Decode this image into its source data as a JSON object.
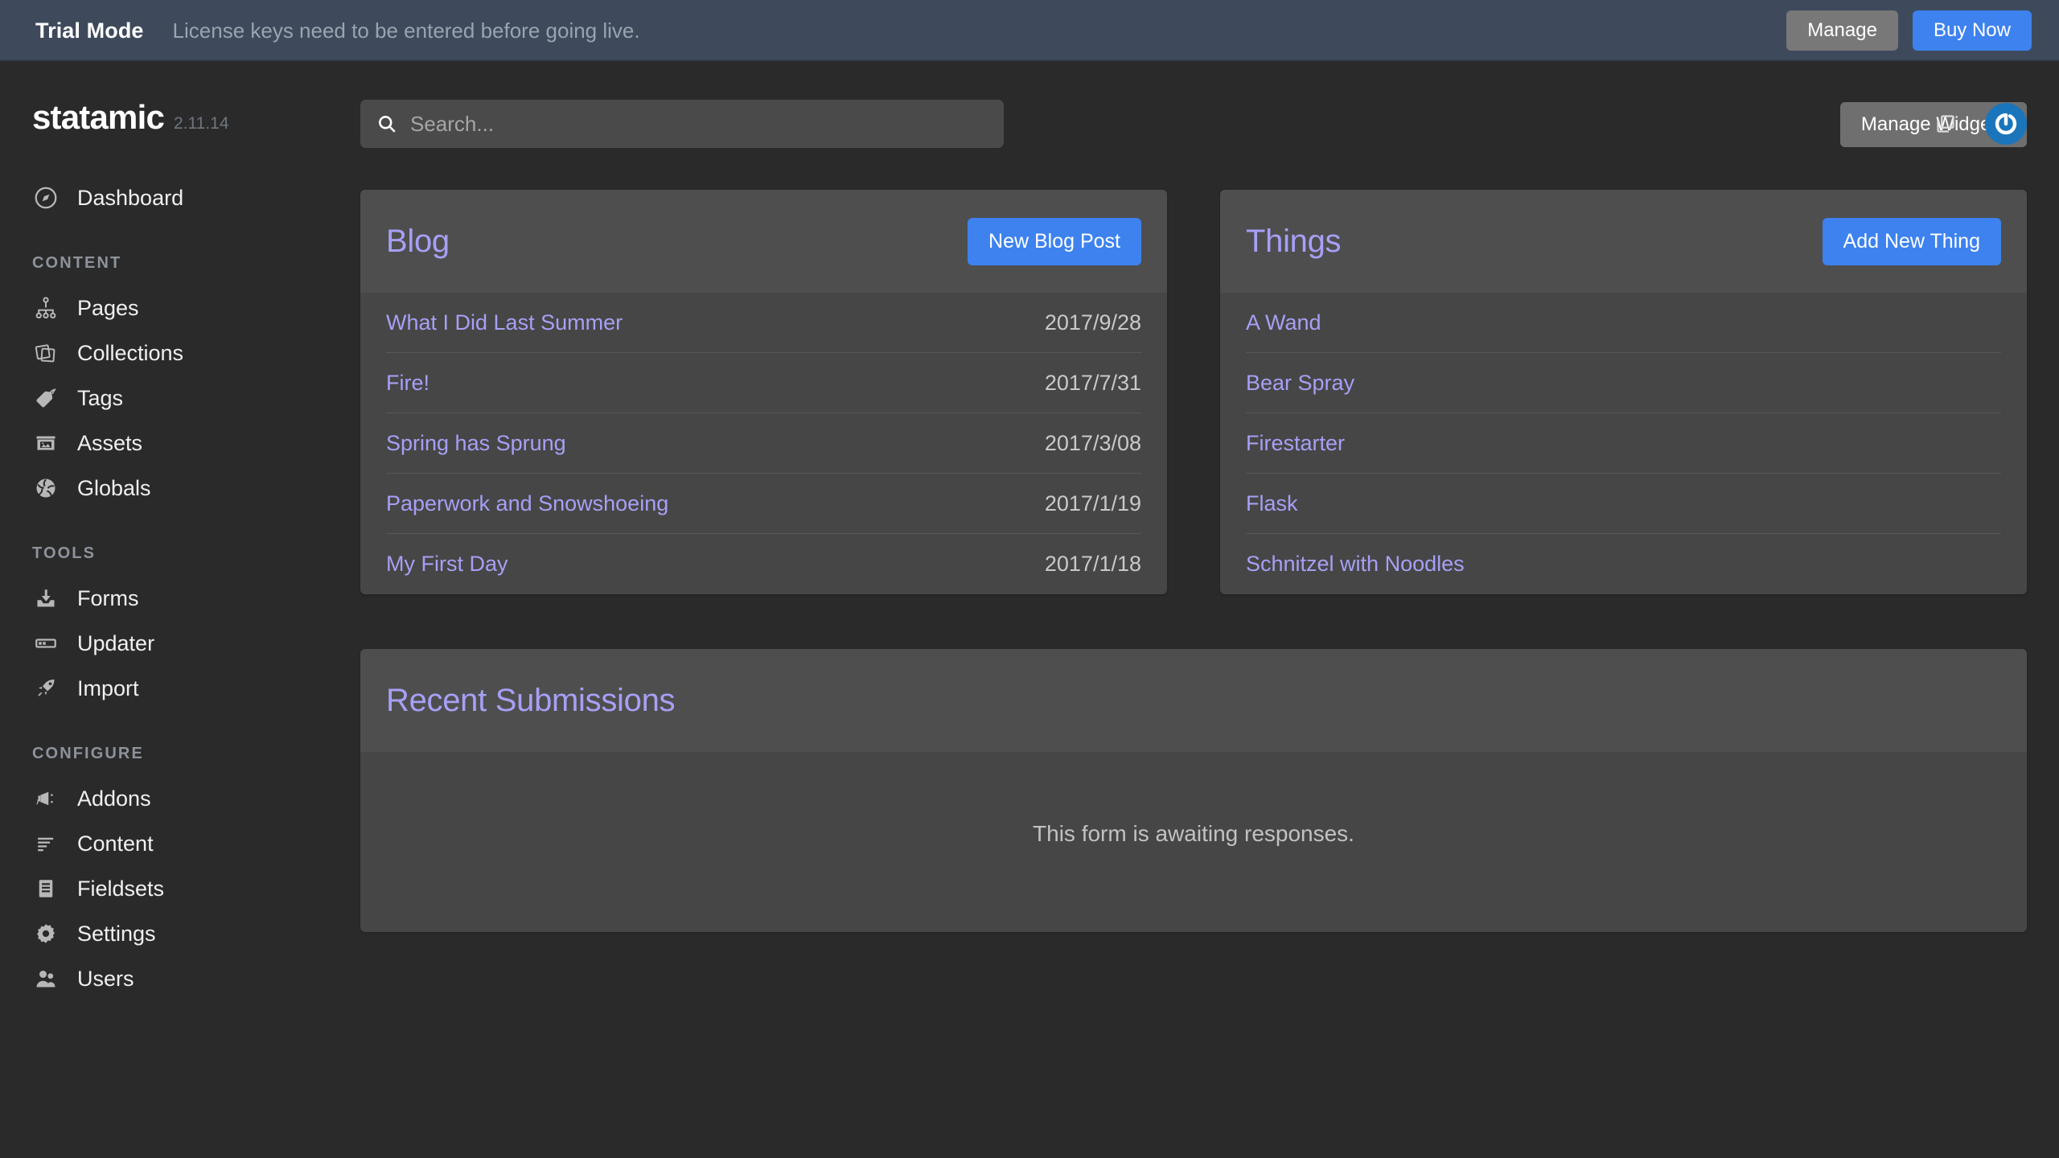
{
  "trial_bar": {
    "title": "Trial Mode",
    "message": "License keys need to be entered before going live.",
    "manage_label": "Manage",
    "buy_label": "Buy Now",
    "background_color": "#3e4a5c",
    "buy_color": "#3d82ef",
    "manage_color": "#787878"
  },
  "brand": {
    "name": "statamic",
    "version": "2.11.14"
  },
  "search": {
    "placeholder": "Search...",
    "value": "",
    "icon": "search-icon"
  },
  "header": {
    "copy_icon": "copy-windows-icon",
    "avatar_icon": "statamic-avatar-icon",
    "avatar_color": "#1b75bb"
  },
  "page": {
    "title": "Dashboard",
    "manage_widgets_label": "Manage Widgets"
  },
  "sidebar": {
    "primary": [
      {
        "label": "Dashboard",
        "icon": "compass-icon"
      }
    ],
    "sections": [
      {
        "label": "CONTENT",
        "items": [
          {
            "label": "Pages",
            "icon": "sitemap-icon"
          },
          {
            "label": "Collections",
            "icon": "stack-icon"
          },
          {
            "label": "Tags",
            "icon": "tag-icon"
          },
          {
            "label": "Assets",
            "icon": "image-folder-icon"
          },
          {
            "label": "Globals",
            "icon": "globe-icon"
          }
        ]
      },
      {
        "label": "TOOLS",
        "items": [
          {
            "label": "Forms",
            "icon": "inbox-download-icon"
          },
          {
            "label": "Updater",
            "icon": "progress-bar-icon"
          },
          {
            "label": "Import",
            "icon": "rocket-icon"
          }
        ]
      },
      {
        "label": "CONFIGURE",
        "items": [
          {
            "label": "Addons",
            "icon": "megaphone-icon"
          },
          {
            "label": "Content",
            "icon": "list-lines-icon"
          },
          {
            "label": "Fieldsets",
            "icon": "document-list-icon"
          },
          {
            "label": "Settings",
            "icon": "gear-icon"
          },
          {
            "label": "Users",
            "icon": "users-icon"
          }
        ]
      }
    ]
  },
  "widgets": {
    "accent_link_color": "#a6a0f5",
    "blog": {
      "title": "Blog",
      "action_label": "New Blog Post",
      "entries": [
        {
          "title": "What I Did Last Summer",
          "date": "2017/9/28"
        },
        {
          "title": "Fire!",
          "date": "2017/7/31"
        },
        {
          "title": "Spring has Sprung",
          "date": "2017/3/08"
        },
        {
          "title": "Paperwork and Snowshoeing",
          "date": "2017/1/19"
        },
        {
          "title": "My First Day",
          "date": "2017/1/18"
        }
      ]
    },
    "things": {
      "title": "Things",
      "action_label": "Add New Thing",
      "entries": [
        {
          "title": "A Wand"
        },
        {
          "title": "Bear Spray"
        },
        {
          "title": "Firestarter"
        },
        {
          "title": "Flask"
        },
        {
          "title": "Schnitzel with Noodles"
        }
      ]
    },
    "submissions": {
      "title": "Recent Submissions",
      "empty_message": "This form is awaiting responses."
    }
  }
}
